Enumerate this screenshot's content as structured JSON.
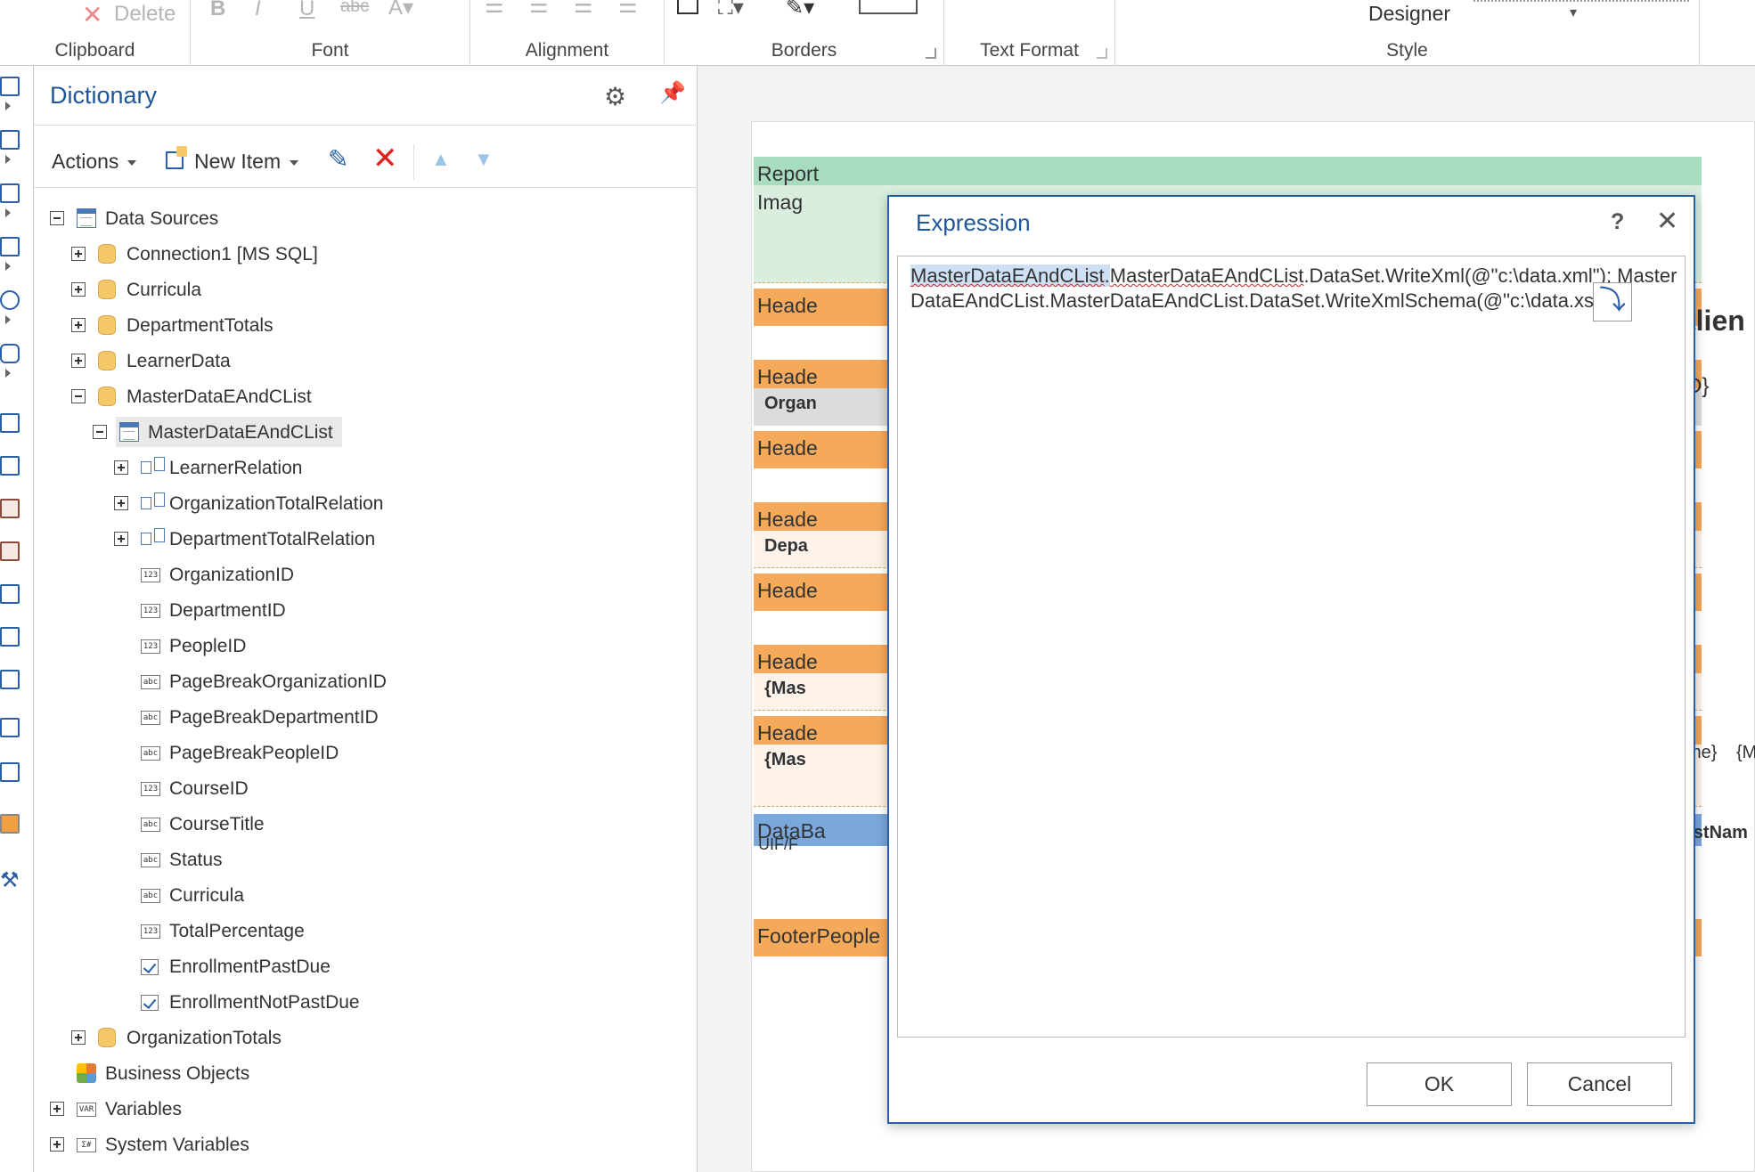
{
  "ribbon": {
    "clipboard": {
      "delete_label": "Delete",
      "group_label": "Clipboard"
    },
    "font": {
      "group_label": "Font",
      "bold": "B",
      "italic": "I",
      "underline": "U",
      "strike": "abc"
    },
    "alignment": {
      "group_label": "Alignment"
    },
    "borders": {
      "group_label": "Borders"
    },
    "text_format": {
      "group_label": "Text Format"
    },
    "style": {
      "designer_label": "Designer",
      "group_label": "Style"
    }
  },
  "dictionary": {
    "title": "Dictionary",
    "toolbar": {
      "actions_label": "Actions",
      "new_item_label": "New Item"
    },
    "tree": [
      {
        "label": "Data Sources",
        "level": 0,
        "icon": "table",
        "expander": "minus"
      },
      {
        "label": "Connection1 [MS SQL]",
        "level": 1,
        "icon": "db",
        "expander": "plus"
      },
      {
        "label": "Curricula",
        "level": 1,
        "icon": "db",
        "expander": "plus"
      },
      {
        "label": "DepartmentTotals",
        "level": 1,
        "icon": "db",
        "expander": "plus"
      },
      {
        "label": "LearnerData",
        "level": 1,
        "icon": "db",
        "expander": "plus"
      },
      {
        "label": "MasterDataEAndCList",
        "level": 1,
        "icon": "db",
        "expander": "minus"
      },
      {
        "label": "MasterDataEAndCList",
        "level": 2,
        "icon": "table",
        "expander": "minus",
        "selected": true
      },
      {
        "label": "LearnerRelation",
        "level": 3,
        "icon": "rel",
        "expander": "plus"
      },
      {
        "label": "OrganizationTotalRelation",
        "level": 3,
        "icon": "rel",
        "expander": "plus"
      },
      {
        "label": "DepartmentTotalRelation",
        "level": 3,
        "icon": "rel",
        "expander": "plus"
      },
      {
        "label": "OrganizationID",
        "level": 3,
        "icon": "123",
        "expander": "none"
      },
      {
        "label": "DepartmentID",
        "level": 3,
        "icon": "123",
        "expander": "none"
      },
      {
        "label": "PeopleID",
        "level": 3,
        "icon": "123",
        "expander": "none"
      },
      {
        "label": "PageBreakOrganizationID",
        "level": 3,
        "icon": "abc",
        "expander": "none"
      },
      {
        "label": "PageBreakDepartmentID",
        "level": 3,
        "icon": "abc",
        "expander": "none"
      },
      {
        "label": "PageBreakPeopleID",
        "level": 3,
        "icon": "abc",
        "expander": "none"
      },
      {
        "label": "CourseID",
        "level": 3,
        "icon": "123",
        "expander": "none"
      },
      {
        "label": "CourseTitle",
        "level": 3,
        "icon": "abc",
        "expander": "none"
      },
      {
        "label": "Status",
        "level": 3,
        "icon": "abc",
        "expander": "none"
      },
      {
        "label": "Curricula",
        "level": 3,
        "icon": "abc",
        "expander": "none"
      },
      {
        "label": "TotalPercentage",
        "level": 3,
        "icon": "123",
        "expander": "none"
      },
      {
        "label": "EnrollmentPastDue",
        "level": 3,
        "icon": "check",
        "expander": "none"
      },
      {
        "label": "EnrollmentNotPastDue",
        "level": 3,
        "icon": "check",
        "expander": "none"
      },
      {
        "label": "OrganizationTotals",
        "level": 1,
        "icon": "db",
        "expander": "plus"
      },
      {
        "label": "Business Objects",
        "level": 0,
        "icon": "bo",
        "expander": "none"
      },
      {
        "label": "Variables",
        "level": 0,
        "icon": "var",
        "expander": "plus"
      },
      {
        "label": "System Variables",
        "level": 0,
        "icon": "sys",
        "expander": "plus"
      }
    ]
  },
  "report": {
    "bands": [
      {
        "text": "Report",
        "color": "#a8dcc0"
      },
      {
        "text": "Imag",
        "color": "#d9eedf"
      },
      {
        "text": "Heade",
        "color": "#f5a95a"
      },
      {
        "text": "Heade",
        "color": "#f5a95a"
      },
      {
        "text": "Organ",
        "color": "#dcdcdc"
      },
      {
        "text": "Heade",
        "color": "#f5a95a"
      },
      {
        "text": "Heade",
        "color": "#f5a95a"
      },
      {
        "text": "Depa",
        "color": "#fdf3ea"
      },
      {
        "text": "Heade",
        "color": "#f5a95a"
      },
      {
        "text": "Heade",
        "color": "#f5a95a"
      },
      {
        "text": "{Mas",
        "color": "#fdf3ea"
      },
      {
        "text": "Heade",
        "color": "#f5a95a"
      },
      {
        "text": "{Mas",
        "color": "#fdf3ea"
      },
      {
        "text": "DataBa",
        "color": "#7aa7dc"
      },
      {
        "text": "FooterPeople",
        "color": "#f5a95a"
      }
    ],
    "right_edge": {
      "clien": "tlien",
      "d": "D}",
      "brace": "}",
      "me": "me}",
      "m": "{M",
      "firstname": "rstNam",
      "uif": "UIF/F"
    }
  },
  "expression_dialog": {
    "title": "Expression",
    "help": "?",
    "code_part1": "MasterDataEAndCList",
    "code_part2": ".",
    "code_part3": "MasterDataEAndCList",
    "code_part4": ".DataSet.WriteXml(@\"c:\\data.xml\"); MasterDataEAndCList.MasterDataEAndCList.DataSet.WriteXmlSchema(@\"c:\\data.xsd\")",
    "ok_label": "OK",
    "cancel_label": "Cancel"
  },
  "colors": {
    "accent": "#1e5799",
    "delete_red": "#e02020",
    "band_orange": "#f5a95a"
  }
}
